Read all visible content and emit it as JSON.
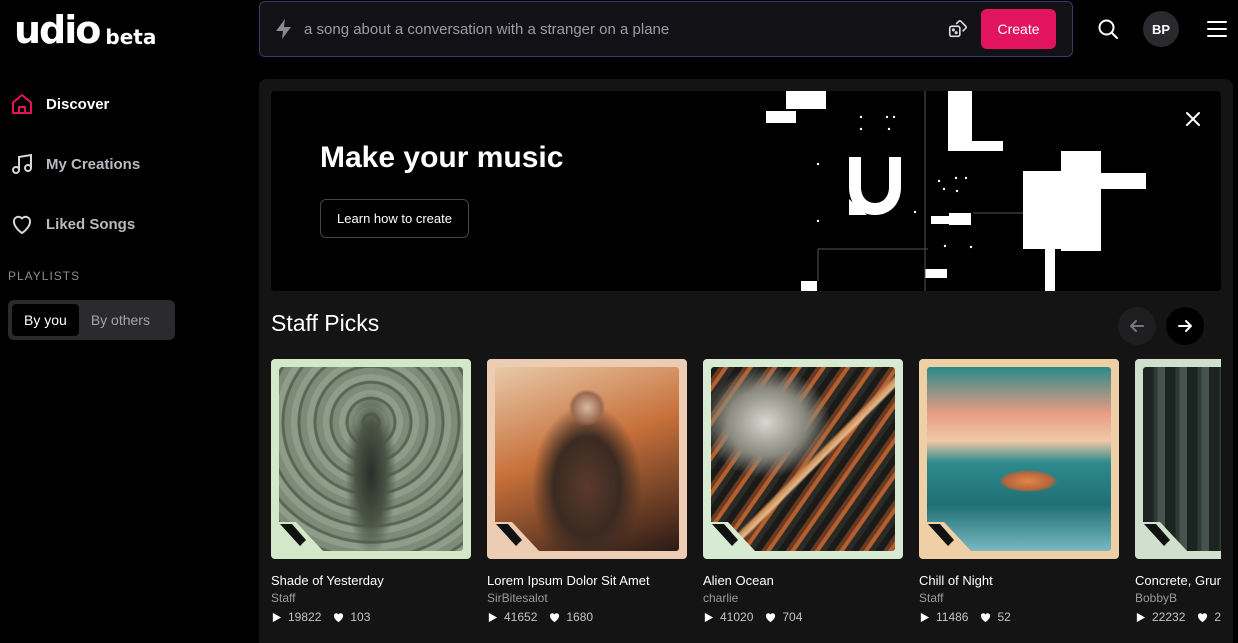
{
  "logo": {
    "name": "udio",
    "badge": "beta"
  },
  "sidebar": {
    "items": [
      {
        "label": "Discover",
        "icon": "home-icon",
        "active": true
      },
      {
        "label": "My Creations",
        "icon": "music-note-icon"
      },
      {
        "label": "Liked Songs",
        "icon": "heart-icon"
      }
    ],
    "playlists_label": "PLAYLISTS",
    "toggle": {
      "by_you": "By you",
      "by_others": "By others",
      "selected": "By you"
    }
  },
  "topbar": {
    "prompt_placeholder": "a song about a conversation with a stranger on a plane",
    "create_label": "Create",
    "avatar_initials": "BP"
  },
  "banner": {
    "title": "Make your music",
    "button_label": "Learn how to create"
  },
  "staff_picks": {
    "title": "Staff Picks",
    "cards": [
      {
        "title": "Shade of Yesterday",
        "author": "Staff",
        "plays": "19822",
        "likes": "103",
        "frame": "#d3e8c8"
      },
      {
        "title": "Lorem Ipsum Dolor Sit Amet",
        "author": "SirBitesalot",
        "plays": "41652",
        "likes": "1680",
        "frame": "#eccdb3"
      },
      {
        "title": "Alien Ocean",
        "author": "charlie",
        "plays": "41020",
        "likes": "704",
        "frame": "#d6ebd2"
      },
      {
        "title": "Chill of Night",
        "author": "Staff",
        "plays": "11486",
        "likes": "52",
        "frame": "#efcfa6"
      },
      {
        "title": "Concrete, Grur",
        "author": "BobbyB",
        "plays": "22232",
        "likes": "2(",
        "frame": "#cfe0cc"
      }
    ]
  },
  "colors": {
    "accent": "#e3145f",
    "panel": "#141414"
  }
}
